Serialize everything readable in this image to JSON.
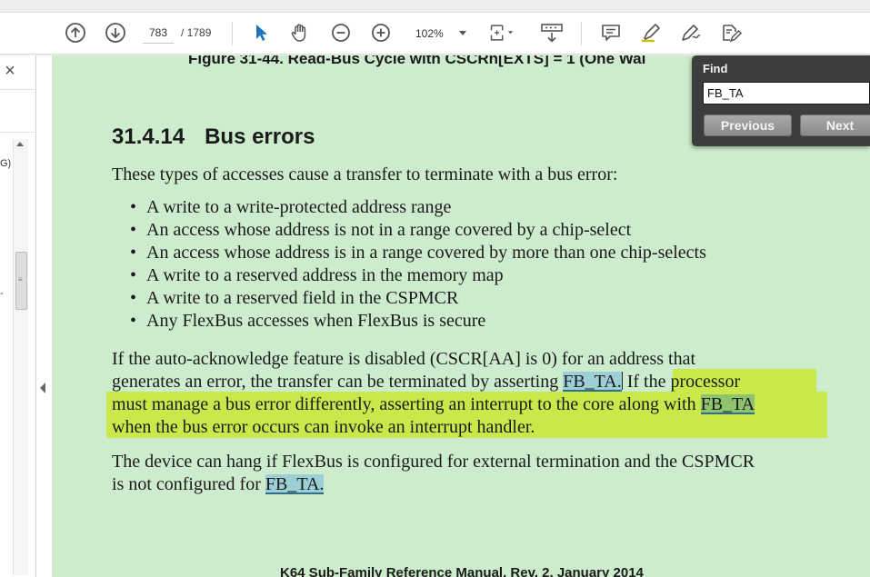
{
  "toolbar": {
    "page_current": "783",
    "page_total": "/ 1789",
    "zoom": "102%"
  },
  "document": {
    "figure_caption": "Figure 31-44. Read-Bus Cycle with CSCRn[EXTS] = 1 (One Wai",
    "section_number": "31.4.14",
    "section_title": "Bus errors",
    "intro": "These types of accesses cause a transfer to terminate with a bus error:",
    "bullets": [
      "A write to a write-protected address range",
      "An access whose address is not in a range covered by a chip-select",
      "An access whose address is in a range covered by more than one chip-selects",
      "A write to a reserved address in the memory map",
      "A write to a reserved field in the CSPMCR",
      "Any FlexBus accesses when FlexBus is secure"
    ],
    "para2": {
      "line1": "If the auto-acknowledge feature is disabled (CSCR[AA] is 0) for an address that",
      "line2_a": "generates an error, the transfer can be terminated by asserting ",
      "line2_match": "FB_TA.",
      "line2_b": " If the processor",
      "line3_a": "must manage a bus error differently, asserting an interrupt to the core along with ",
      "line3_match": "FB_TA",
      "line4": "when the bus error occurs can invoke an interrupt handler."
    },
    "para3": {
      "line1": "The device can hang if FlexBus is configured for external termination and the CSPMCR",
      "line2_a": "is not configured for ",
      "line2_match": "FB_TA."
    },
    "footer": "K64 Sub-Family Reference Manual, Rev. 2, January 2014"
  },
  "find": {
    "title": "Find",
    "query": "FB_TA",
    "previous_label": "Previous",
    "next_label": "Next"
  },
  "left_pane": {
    "bookmark_fragment": "G)",
    "tick_fragment": "-"
  },
  "colors": {
    "page_background": "#cdebcd",
    "highlight": "#c9e84a",
    "search_match": "#9ccfd6",
    "toolbar_icon": "#555555",
    "select_tool": "#1e73be"
  }
}
